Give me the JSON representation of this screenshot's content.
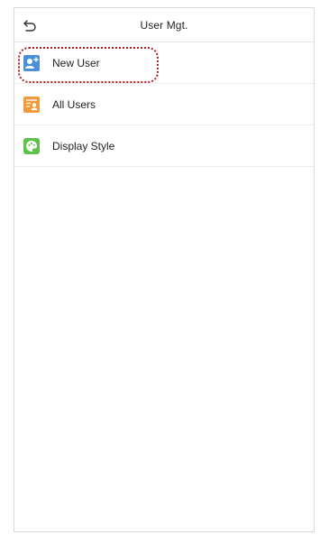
{
  "header": {
    "title": "User Mgt.",
    "back_icon": "back-arrow-icon"
  },
  "menu": {
    "items": [
      {
        "label": "New User",
        "icon": "add-user-icon",
        "icon_color": "#4a90d9",
        "highlighted": true
      },
      {
        "label": "All Users",
        "icon": "user-list-icon",
        "icon_color": "#f39b3c",
        "highlighted": false
      },
      {
        "label": "Display Style",
        "icon": "palette-icon",
        "icon_color": "#5cc24a",
        "highlighted": false
      }
    ]
  },
  "colors": {
    "highlight_border": "#b0202a",
    "divider": "#ececec"
  }
}
